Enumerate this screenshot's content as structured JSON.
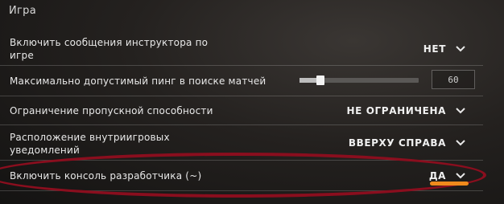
{
  "section": {
    "title": "Игра"
  },
  "settings": {
    "instructor": {
      "label_line1": "Включить сообщения инструктора по",
      "label_line2": "игре",
      "value": "НЕТ"
    },
    "max_ping": {
      "label": "Максимально допустимый пинг в поиске матчей",
      "value": "60",
      "slider_fraction": 0.15
    },
    "bandwidth": {
      "label": "Ограничение пропускной способности",
      "value": "НЕ ОГРАНИЧЕНА"
    },
    "notifications": {
      "label_line1": "Расположение внутриигровых",
      "label_line2": "уведомлений",
      "value": "ВВЕРХУ СПРАВА"
    },
    "dev_console": {
      "label": "Включить консоль разработчика (~)",
      "value": "ДА"
    }
  },
  "colors": {
    "highlight_ellipse": "#8a0e1e",
    "accent_underline": "#f08a1c"
  },
  "icons": {
    "dropdown": "chevron-down-icon"
  }
}
